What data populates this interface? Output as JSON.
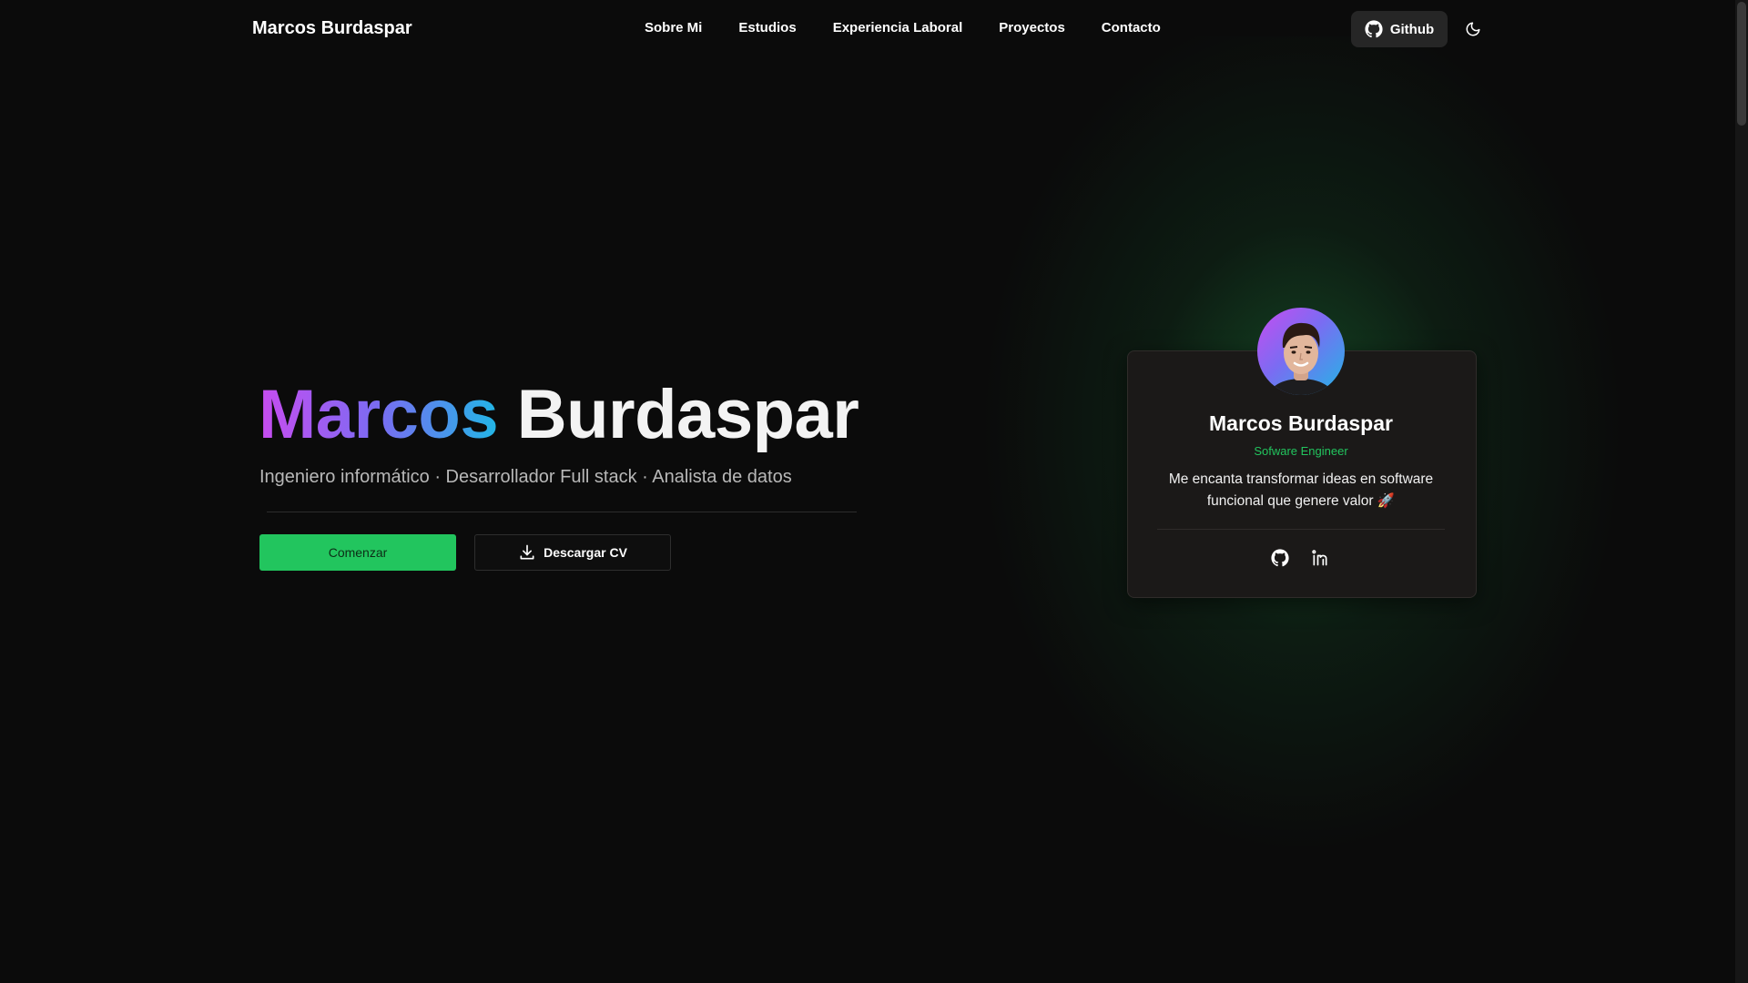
{
  "nav": {
    "brand": "Marcos Burdaspar",
    "links": [
      "Sobre Mi",
      "Estudios",
      "Experiencia Laboral",
      "Proyectos",
      "Contacto"
    ],
    "github_label": "Github",
    "github_icon": "github-icon",
    "theme_icon": "moon-icon"
  },
  "hero": {
    "first_name": "Marcos",
    "last_name": "Burdaspar",
    "subtitle": "Ingeniero informático · Desarrollador Full stack · Analista de datos",
    "start_label": "Comenzar",
    "cv_label": "Descargar CV",
    "cv_icon": "download-icon"
  },
  "card": {
    "name": "Marcos Burdaspar",
    "role": "Sofware Engineer",
    "bio": "Me encanta transformar ideas en software funcional que genere valor 🚀",
    "social_icons": [
      "github-icon",
      "linkedin-icon"
    ]
  },
  "colors": {
    "background": "#0b0b0b",
    "accent_green": "#22c55e",
    "gradient": [
      "#c84cf0",
      "#7a6cf2",
      "#22b6e6"
    ],
    "card_bg": "#1b1918"
  }
}
